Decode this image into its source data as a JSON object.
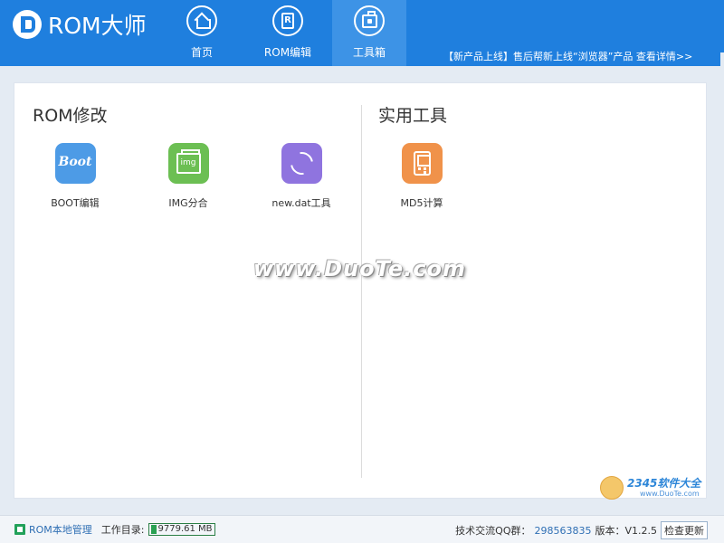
{
  "app": {
    "title": "ROM大师"
  },
  "nav": [
    {
      "label": "首页",
      "icon": "home-icon"
    },
    {
      "label": "ROM编辑",
      "icon": "rom-edit-icon"
    },
    {
      "label": "工具箱",
      "icon": "toolbox-icon",
      "active": true
    }
  ],
  "promo": "【新产品上线】售后帮新上线“浏览器”产品  查看详情>>",
  "sections": {
    "rom": {
      "title": "ROM修改",
      "tools": [
        {
          "label": "BOOT编辑",
          "icon_text": "Boot",
          "color": "#4d9be6"
        },
        {
          "label": "IMG分合",
          "icon_text": "img",
          "color": "#6cbf53"
        },
        {
          "label": "new.dat工具",
          "color": "#8f74df"
        }
      ]
    },
    "util": {
      "title": "实用工具",
      "tools": [
        {
          "label": "MD5计算",
          "color": "#f0924a"
        }
      ]
    }
  },
  "watermark": {
    "site": "www.DuoTe.com",
    "brand": "2345软件大全",
    "brand_url": "www.DuoTe.com"
  },
  "status": {
    "local_manage": "ROM本地管理",
    "workdir_label": "工作目录:",
    "disk_free": "9779.61 MB",
    "qq_label": "技术交流QQ群：",
    "qq_number": "298563835",
    "version": "版本：V1.2.5",
    "check_update": "检查更新"
  },
  "colors": {
    "header": "#1f7fde",
    "nav_active": "#3d93e6",
    "link": "#2f6fb4"
  }
}
